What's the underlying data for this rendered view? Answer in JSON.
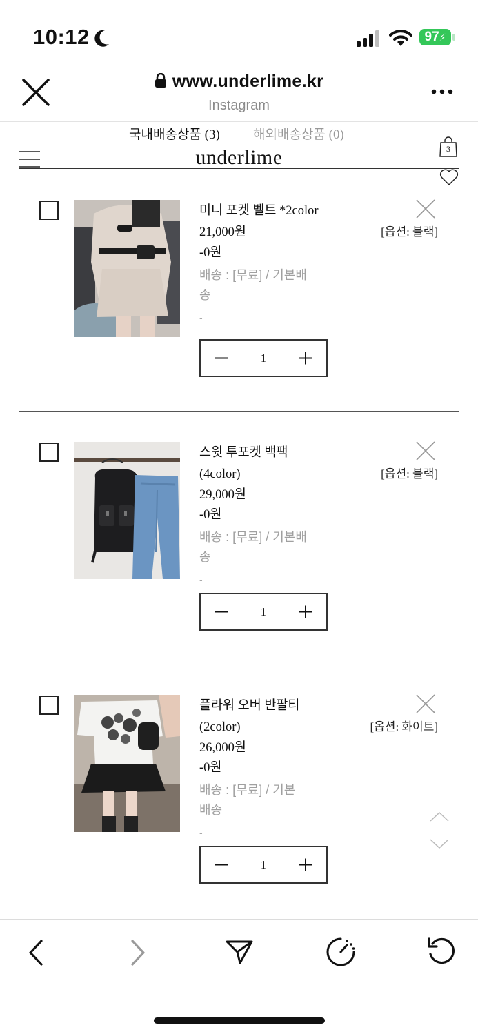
{
  "status_bar": {
    "time": "10:12",
    "battery": "97"
  },
  "browser": {
    "url": "www.underlime.kr",
    "source": "Instagram"
  },
  "shop": {
    "tabs": [
      {
        "label": "국내배송상품 (3)"
      },
      {
        "label": "해외배송상품 (0)"
      }
    ],
    "logo": "underlime",
    "cart_count": "3"
  },
  "items": [
    {
      "name": "미니 포켓 벨트 *2color",
      "name2": "",
      "price": "21,000원",
      "discount": "-0원",
      "shipping1": "배송 : [무료] / 기본배",
      "shipping2": "송",
      "dash": "-",
      "option": "[옵션: 블랙]",
      "qty": "1"
    },
    {
      "name": "스윗 투포켓 백팩",
      "name2": "(4color)",
      "price": "29,000원",
      "discount": "-0원",
      "shipping1": "배송 : [무료] / 기본배",
      "shipping2": "송",
      "dash": "-",
      "option": "[옵션: 블랙]",
      "qty": "1"
    },
    {
      "name": "플라워 오버 반팔티",
      "name2": "(2color)",
      "price": "26,000원",
      "discount": "-0원",
      "shipping1": "배송 : [무료] / 기본",
      "shipping2": "배송",
      "dash": "-",
      "option": "[옵션: 화이트]",
      "qty": "1"
    }
  ]
}
